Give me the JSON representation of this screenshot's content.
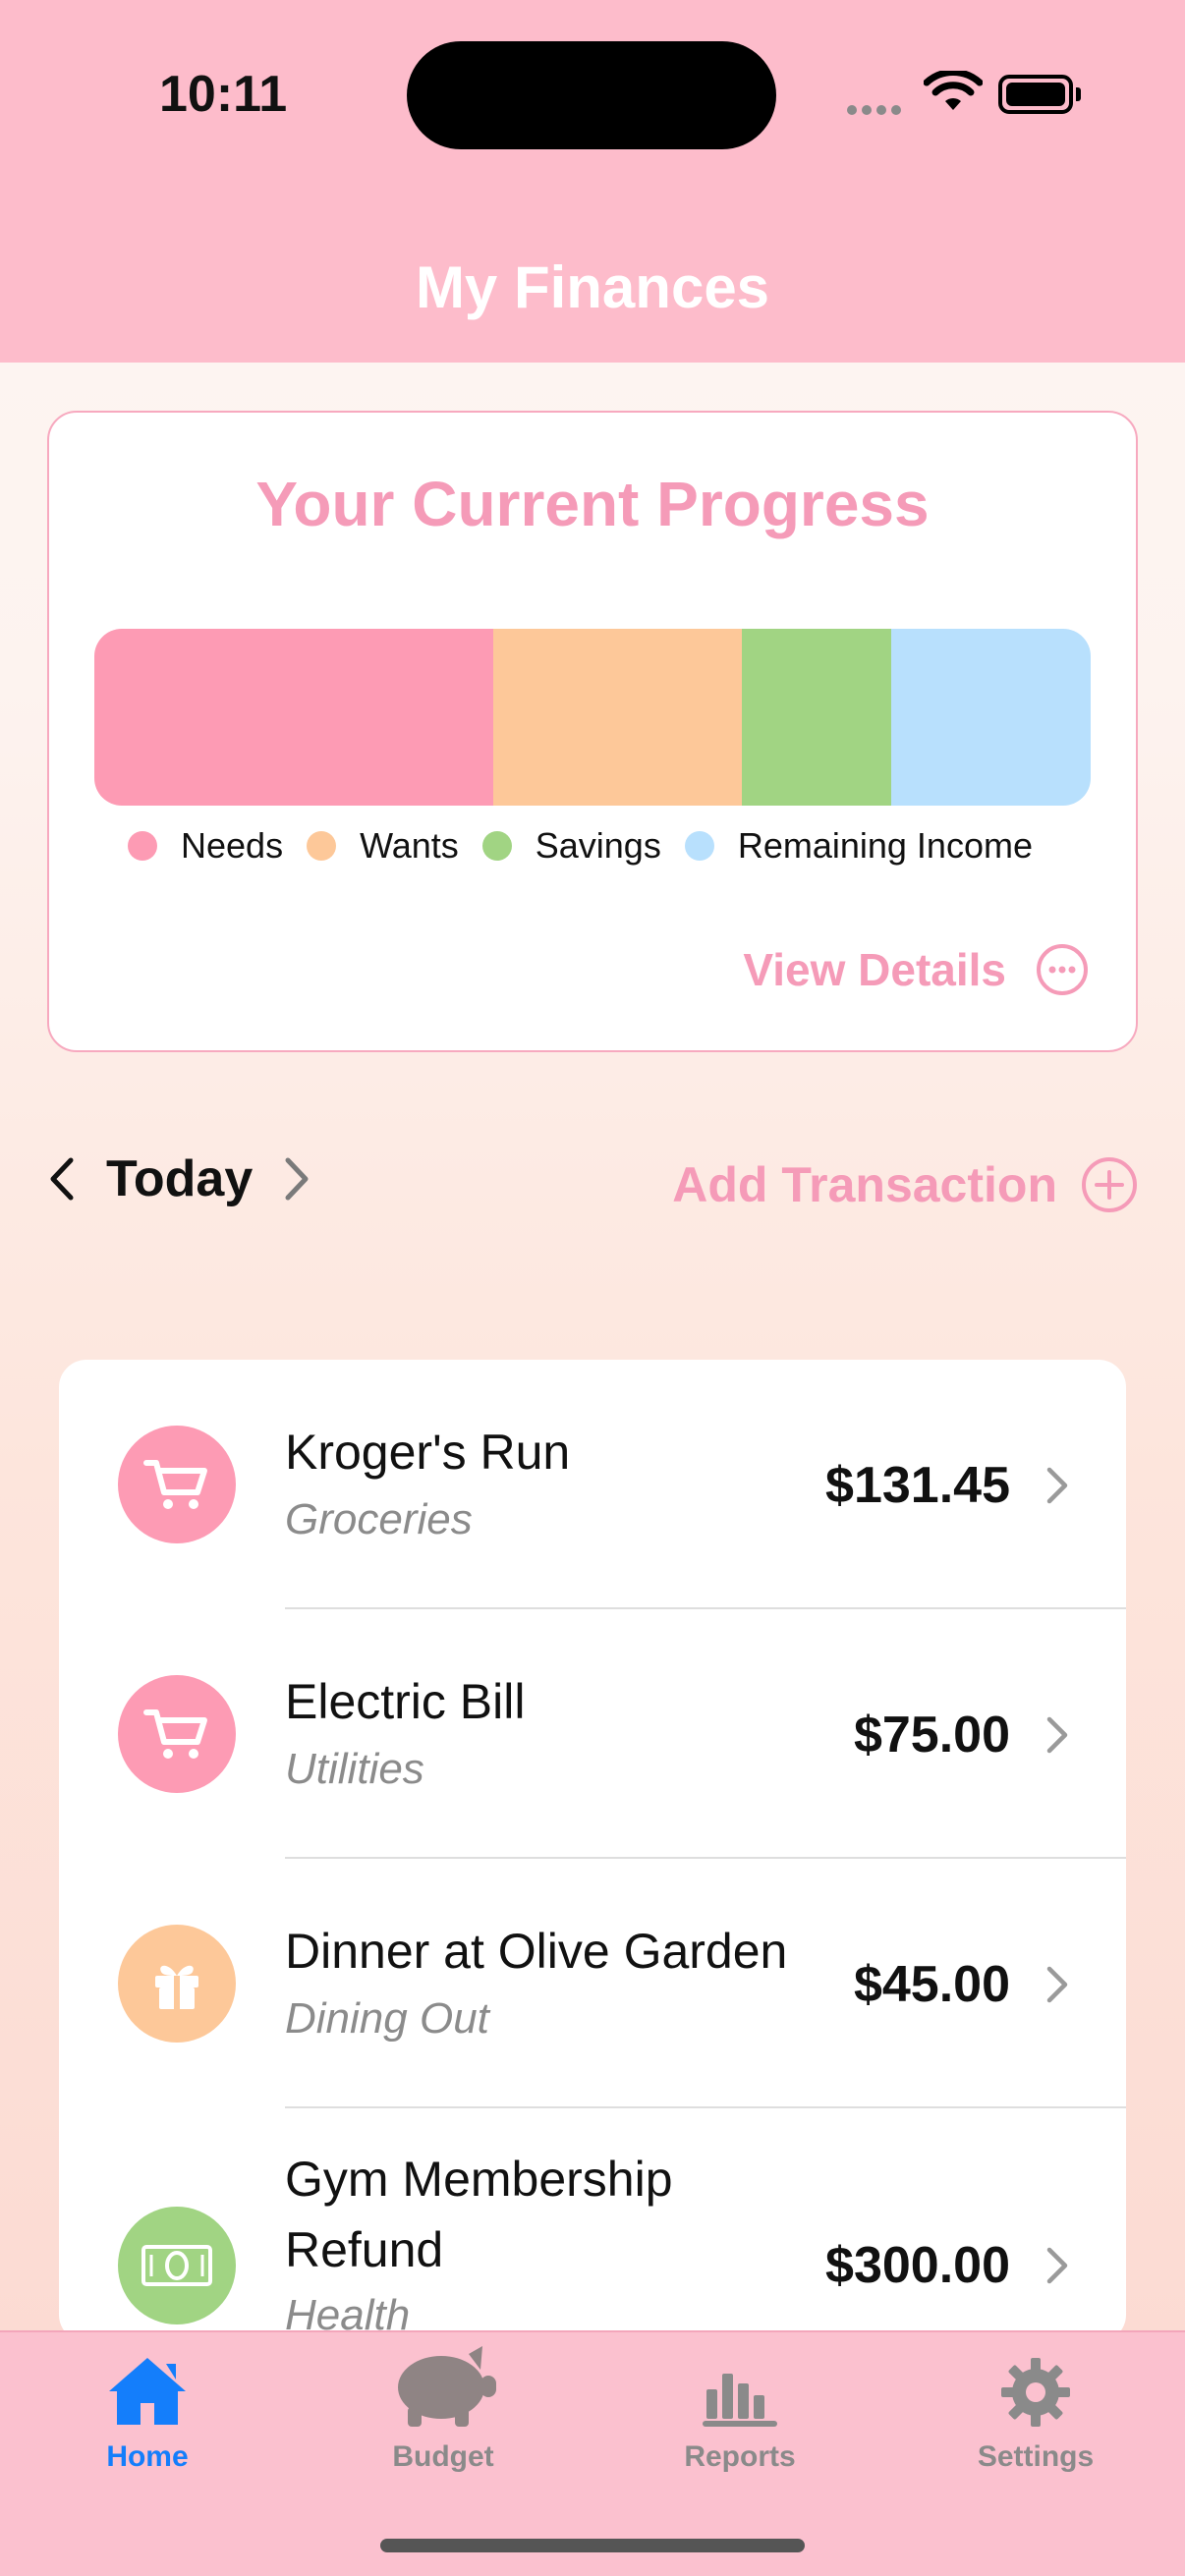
{
  "status_bar": {
    "time": "10:11"
  },
  "header": {
    "title": "My Finances"
  },
  "progress": {
    "title": "Your Current Progress",
    "segments": [
      {
        "label": "Needs",
        "fraction": 0.4,
        "color": "#fd9bb4"
      },
      {
        "label": "Wants",
        "fraction": 0.25,
        "color": "#fdc899"
      },
      {
        "label": "Savings",
        "fraction": 0.15,
        "color": "#a1d483"
      },
      {
        "label": "Remaining Income",
        "fraction": 0.2,
        "color": "#b8e0fd"
      }
    ],
    "view_details": "View Details"
  },
  "date_nav": {
    "label": "Today"
  },
  "add_transaction": "Add Transaction",
  "transactions": [
    {
      "name": "Kroger's Run",
      "category": "Groceries",
      "amount": "$131.45",
      "icon": "cart-icon",
      "icon_color": "#fd9bb4"
    },
    {
      "name": "Electric Bill",
      "category": "Utilities",
      "amount": "$75.00",
      "icon": "cart-icon",
      "icon_color": "#fd9bb4"
    },
    {
      "name": "Dinner at Olive Garden",
      "category": "Dining Out",
      "amount": "$45.00",
      "icon": "gift-icon",
      "icon_color": "#fdc899"
    },
    {
      "name_line1": "Gym Membership",
      "name_line2": "Refund",
      "category": "Health",
      "amount": "$300.00",
      "icon": "banknote-icon",
      "icon_color": "#a1d483"
    }
  ],
  "tabs": [
    {
      "label": "Home",
      "icon": "house-icon",
      "active": true,
      "color": "#147efb"
    },
    {
      "label": "Budget",
      "icon": "piggy-bank-icon",
      "active": false,
      "color": "#8a8a8a"
    },
    {
      "label": "Reports",
      "icon": "bar-chart-icon",
      "active": false,
      "color": "#8a8a8a"
    },
    {
      "label": "Settings",
      "icon": "gear-icon",
      "active": false,
      "color": "#8a8a8a"
    }
  ]
}
